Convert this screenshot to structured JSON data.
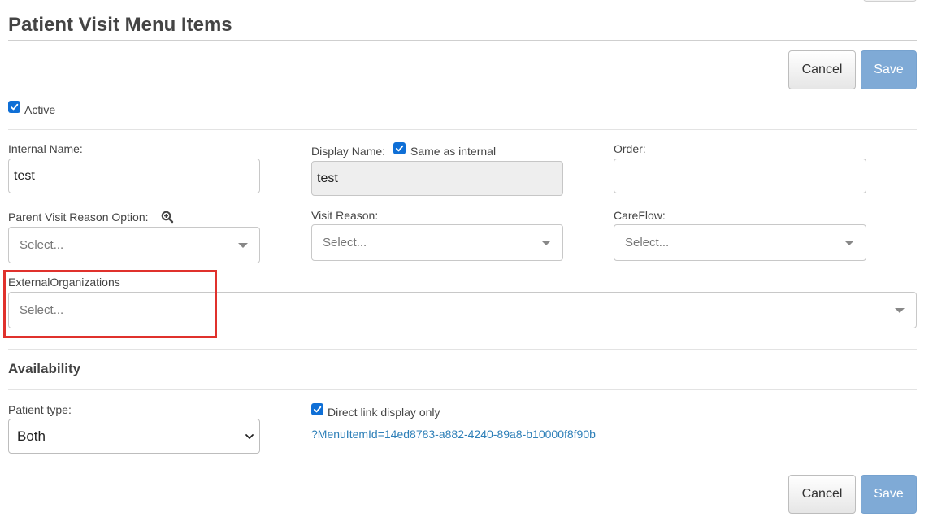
{
  "page": {
    "title": "Patient Visit Menu Items"
  },
  "actions": {
    "cancel_label": "Cancel",
    "save_label": "Save"
  },
  "active": {
    "label": "Active",
    "checked": true
  },
  "internal_name": {
    "label": "Internal Name:",
    "value": "test"
  },
  "display_name": {
    "label": "Display Name:",
    "same_as_internal_label": "Same as internal",
    "same_as_internal_checked": true,
    "value": "test"
  },
  "order": {
    "label": "Order:",
    "value": ""
  },
  "parent_visit_reason": {
    "label": "Parent Visit Reason Option:",
    "placeholder": "Select...",
    "icon": "zoom-in-icon"
  },
  "visit_reason": {
    "label": "Visit Reason:",
    "placeholder": "Select..."
  },
  "careflow": {
    "label": "CareFlow:",
    "placeholder": "Select..."
  },
  "external_organizations": {
    "label": "ExternalOrganizations",
    "placeholder": "Select...",
    "highlight_color": "#e0312c"
  },
  "availability": {
    "title": "Availability",
    "patient_type": {
      "label": "Patient type:",
      "selected": "Both"
    },
    "direct_link": {
      "label": "Direct link display only",
      "checked": true
    },
    "menu_link": "?MenuItemId=14ed8783-a882-4240-89a8-b10000f8f90b"
  },
  "colors": {
    "accent": "#0f6fd6",
    "save_button": "#7faad6",
    "link": "#2d7fb8"
  }
}
